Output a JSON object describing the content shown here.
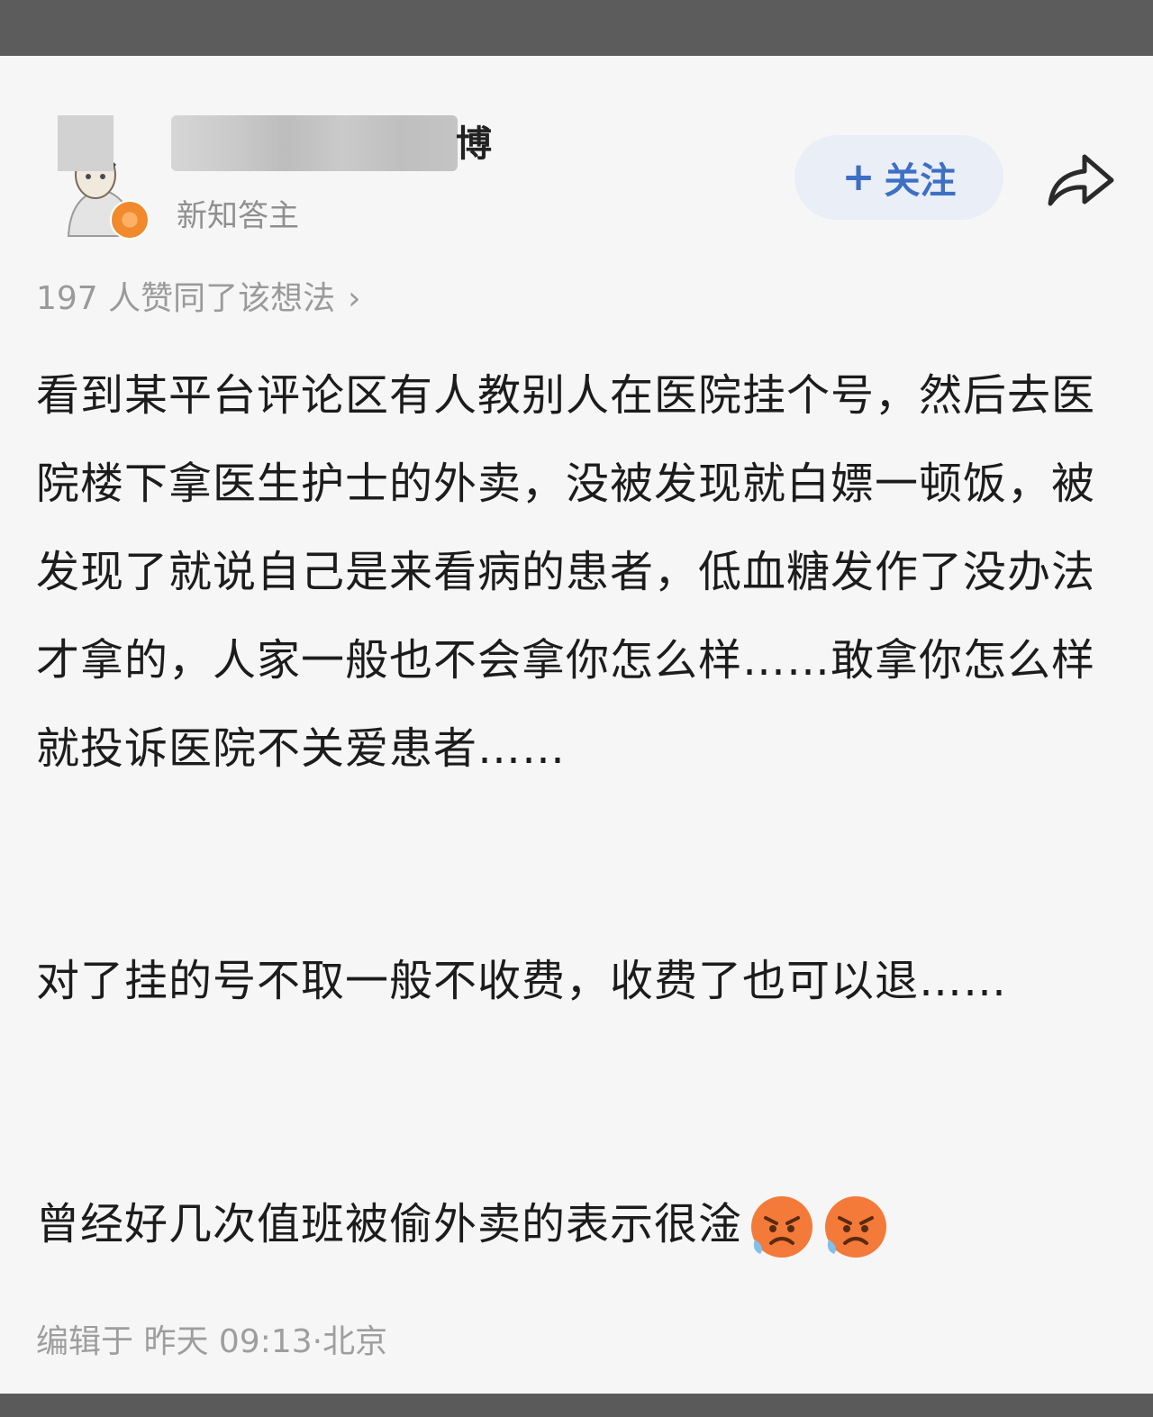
{
  "post": {
    "author": {
      "name_suffix": "博",
      "badge_text": "新知答主"
    },
    "follow_button": {
      "label": "关注",
      "icon": "plus-icon"
    },
    "share_icon": "share-icon",
    "likes_text": "197 人赞同了该想法",
    "likes_chevron": "›",
    "paragraphs": [
      "看到某平台评论区有人教别人在医院挂个号，然后去医院楼下拿医生护士的外卖，没被发现就白嫖一顿饭，被发现了就说自己是来看病的患者，低血糖发作了没办法才拿的，人家一般也不会拿你怎么样……敢拿你怎么样就投诉医院不关爱患者……",
      "对了挂的号不取一般不收费，收费了也可以退……",
      "曾经好几次值班被偷外卖的表示很淦"
    ],
    "emojis": [
      "angry-face-icon",
      "angry-face-icon"
    ],
    "footer": "编辑于 昨天 09:13·北京"
  },
  "colors": {
    "background": "#f6f6f6",
    "frame": "#5a5a5a",
    "accent": "#3d6fc4",
    "follow_bg": "#e9eef7",
    "badge": "#f08a2c"
  }
}
